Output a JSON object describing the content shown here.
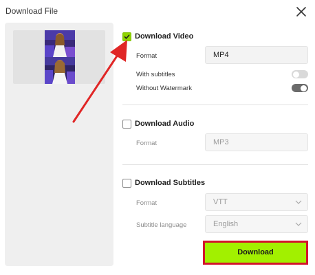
{
  "dialog": {
    "title": "Download File"
  },
  "icons": {
    "close": "close-icon",
    "check": "check-icon",
    "chevron": "chevron-down-icon"
  },
  "colors": {
    "accent": "#a2f000",
    "highlight_border": "#d3152b",
    "annotation_arrow": "#e02626",
    "checkbox_checked": "#8fd400"
  },
  "video": {
    "checked": true,
    "label": "Download Video",
    "format_label": "Format",
    "format_value": "MP4",
    "subtitles_label": "With subtitles",
    "subtitles_on": false,
    "watermark_label": "Without Watermark",
    "watermark_on": true
  },
  "audio": {
    "checked": false,
    "label": "Download Audio",
    "format_label": "Format",
    "format_value": "MP3"
  },
  "subtitles": {
    "checked": false,
    "label": "Download Subtitles",
    "format_label": "Format",
    "format_value": "VTT",
    "language_label": "Subtitle language",
    "language_value": "English"
  },
  "actions": {
    "download_label": "Download"
  }
}
